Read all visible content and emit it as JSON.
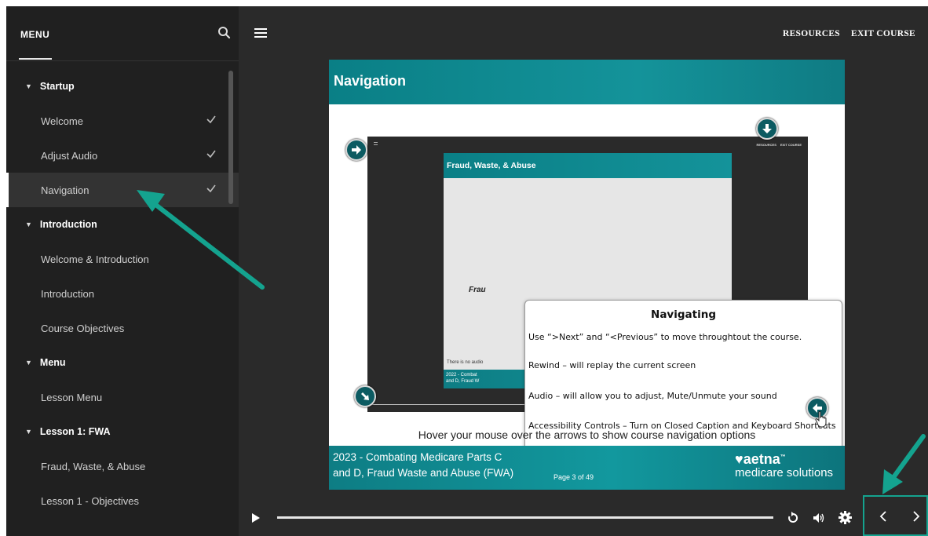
{
  "colors": {
    "teal_accent": "#14a38f",
    "slide_teal": "#12989e",
    "sidebar_bg": "#202020",
    "stage_bg": "#2a2a2a"
  },
  "sidebar": {
    "title": "MENU",
    "search_icon": "search-icon",
    "sections": [
      {
        "label": "Startup",
        "items": [
          {
            "label": "Welcome",
            "completed": true
          },
          {
            "label": "Adjust Audio",
            "completed": true
          },
          {
            "label": "Navigation",
            "completed": true,
            "active": true
          }
        ]
      },
      {
        "label": "Introduction",
        "items": [
          {
            "label": "Welcome & Introduction"
          },
          {
            "label": "Introduction"
          },
          {
            "label": "Course Objectives"
          }
        ]
      },
      {
        "label": "Menu",
        "items": [
          {
            "label": "Lesson Menu"
          }
        ]
      },
      {
        "label": "Lesson 1: FWA",
        "items": [
          {
            "label": "Fraud, Waste, & Abuse"
          },
          {
            "label": "Lesson 1 - Objectives"
          }
        ]
      }
    ]
  },
  "topbar": {
    "menu_icon": "hamburger-icon",
    "resources_label": "RESOURCES",
    "exit_label": "EXIT COURSE"
  },
  "slide": {
    "title": "Navigation",
    "hover_caption": "Hover your mouse over the arrows to show course navigation options",
    "footer_line1": "2023 - Combating Medicare Parts C",
    "footer_line2": "and D, Fraud Waste and Abuse (FWA)",
    "page_indicator": "Page 3 of 49",
    "brand_name": "aetna",
    "brand_tm": "™",
    "brand_sub": "medicare solutions",
    "inner": {
      "top_links": [
        "RESOURCES",
        "EXIT COURSE"
      ],
      "slide_title": "Fraud, Waste, & Abuse",
      "partial_text": "Frau",
      "audio_note": "There is no audio",
      "footer_line1": "2022 - Combat",
      "footer_line2": "and D, Fraud W"
    },
    "popup": {
      "title": "Navigating",
      "lines": [
        "Use “>Next” and “<Previous” to move throughtout the course.",
        "Rewind – will replay the current screen",
        "Audio – will allow you to adjust, Mute/Unmute your sound",
        "Accessibility Controls – Turn on Closed Caption and Keyboard Shortcuts"
      ]
    }
  },
  "player": {
    "play_icon": "play-icon",
    "rewind_icon": "rewind-icon",
    "audio_icon": "speaker-icon",
    "settings_icon": "gear-icon",
    "prev_icon": "chevron-left-icon",
    "next_icon": "chevron-right-icon"
  }
}
